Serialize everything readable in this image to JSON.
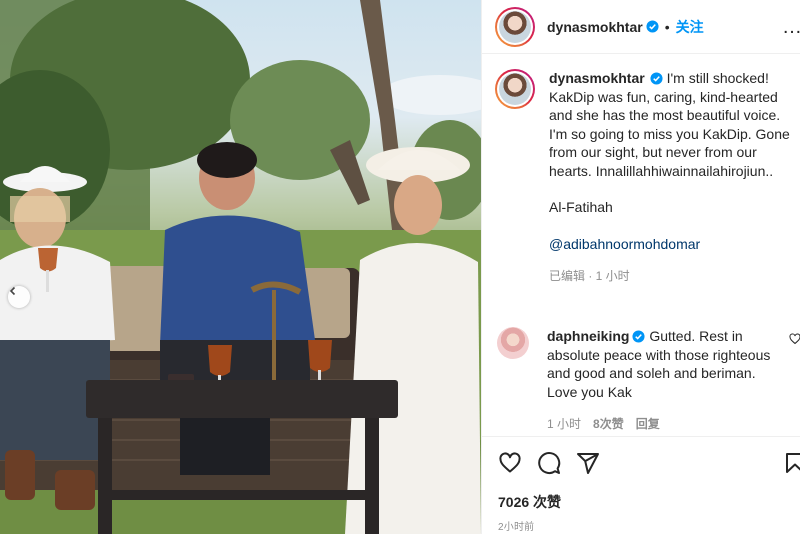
{
  "post": {
    "username": "dynasmokhtar",
    "follow_label": "关注",
    "header_separator": "•",
    "more_label": "…"
  },
  "caption": {
    "username": "dynasmokhtar",
    "text": "I'm still shocked! KakDip was fun, caring, kind-hearted and she has the most beautiful voice. I'm so going to miss you KakDip. Gone from our sight, but never from our hearts. Innalillahhiwainnailahirojiun..",
    "closing": "Al-Fatihah",
    "mention": "@adibahnoormohdomar",
    "meta": "已编辑 · 1 小时"
  },
  "comment": {
    "username": "daphneiking",
    "text": "Gutted. Rest in absolute peace with those righteous and good and soleh and beriman. Love you Kak",
    "time": "1 小时",
    "likes": "8次赞",
    "reply_label": "回复"
  },
  "footer": {
    "likes": "7026 次赞",
    "time": "2小时前"
  },
  "icons": [
    "heart-icon",
    "comment-icon",
    "share-icon",
    "bookmark-icon",
    "verified-badge-icon",
    "chevron-left-icon"
  ],
  "colors": {
    "accent": "#0095f6",
    "verified": "#0095f6",
    "mention": "#00376b",
    "muted": "#8e8e8e"
  }
}
